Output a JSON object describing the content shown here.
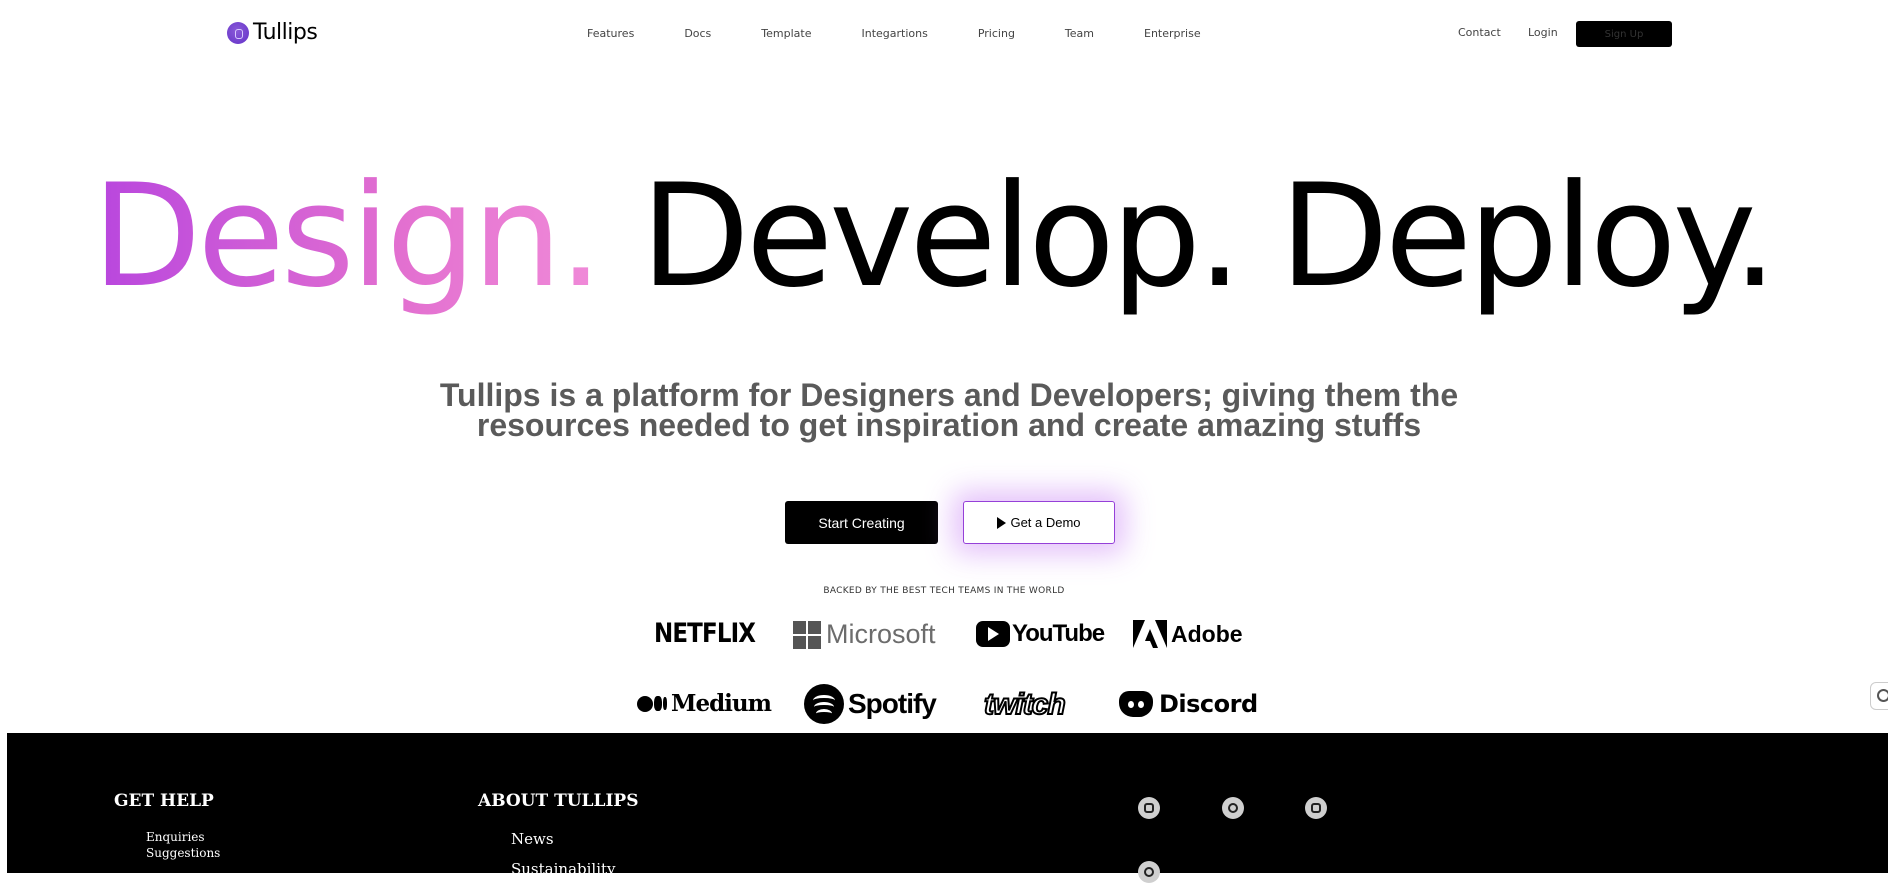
{
  "header": {
    "brand": "Tullips",
    "menu": [
      "Features",
      "Docs",
      "Template",
      "Integartions",
      "Pricing",
      "Team",
      "Enterprise"
    ],
    "contact": "Contact",
    "login": "Login",
    "signup": "Sign Up"
  },
  "hero": {
    "word1": "Design.",
    "word2": "Develop.",
    "word3": "Deploy.",
    "subtitle_line1": "Tullips is a platform for Designers and Developers; giving them the",
    "subtitle_line2": "resources needed to get inspiration and create amazing stuffs",
    "start_button": "Start Creating",
    "demo_button": "Get a Demo",
    "backed": "BACKED BY THE BEST TECH TEAMS IN THE WORLD",
    "gradient_colors": [
      "#b846de",
      "#f08ad8"
    ]
  },
  "brands": {
    "netflix": "NETFLIX",
    "microsoft": "Microsoft",
    "youtube": "YouTube",
    "adobe": "Adobe",
    "medium": "Medium",
    "spotify": "Spotify",
    "twitch": "twitch",
    "discord": "Discord"
  },
  "footer": {
    "get_help": {
      "title": "GET HELP",
      "links": [
        "Enquiries",
        "Suggestions"
      ]
    },
    "about": {
      "title": "ABOUT TULLIPS",
      "links": [
        "News",
        "Sustainability"
      ]
    },
    "social_icons": [
      "instagram-icon",
      "twitter-icon",
      "facebook-icon",
      "pinterest-icon"
    ]
  }
}
